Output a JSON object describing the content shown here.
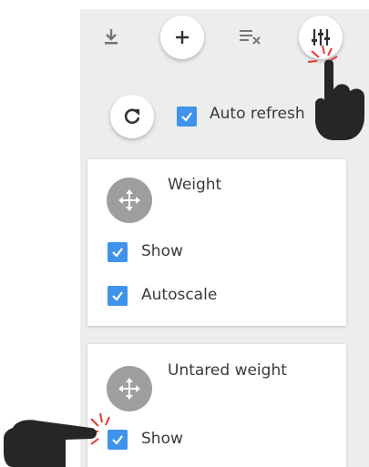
{
  "toolbar": {
    "icons": [
      "download-icon",
      "add-icon",
      "clear-list-icon",
      "sliders-icon"
    ]
  },
  "refresh": {
    "icon": "refresh-icon",
    "auto_refresh_label": "Auto refresh",
    "auto_refresh_checked": true
  },
  "cards": [
    {
      "title": "Weight",
      "options": [
        {
          "label": "Show",
          "checked": true
        },
        {
          "label": "Autoscale",
          "checked": true
        }
      ]
    },
    {
      "title": "Untared weight",
      "options": [
        {
          "label": "Show",
          "checked": true
        }
      ]
    }
  ],
  "colors": {
    "panel_bg": "#ededed",
    "checkbox": "#3f93ea",
    "drag_handle": "#9e9e9e",
    "click_marker": "#e53935",
    "hand": "#262626"
  }
}
